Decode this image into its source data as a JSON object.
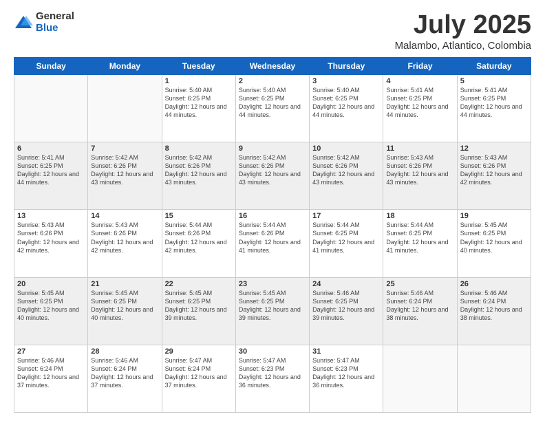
{
  "header": {
    "logo_general": "General",
    "logo_blue": "Blue",
    "title": "July 2025",
    "location": "Malambo, Atlantico, Colombia"
  },
  "days_of_week": [
    "Sunday",
    "Monday",
    "Tuesday",
    "Wednesday",
    "Thursday",
    "Friday",
    "Saturday"
  ],
  "weeks": [
    [
      {
        "day": "",
        "info": ""
      },
      {
        "day": "",
        "info": ""
      },
      {
        "day": "1",
        "info": "Sunrise: 5:40 AM\nSunset: 6:25 PM\nDaylight: 12 hours and 44 minutes."
      },
      {
        "day": "2",
        "info": "Sunrise: 5:40 AM\nSunset: 6:25 PM\nDaylight: 12 hours and 44 minutes."
      },
      {
        "day": "3",
        "info": "Sunrise: 5:40 AM\nSunset: 6:25 PM\nDaylight: 12 hours and 44 minutes."
      },
      {
        "day": "4",
        "info": "Sunrise: 5:41 AM\nSunset: 6:25 PM\nDaylight: 12 hours and 44 minutes."
      },
      {
        "day": "5",
        "info": "Sunrise: 5:41 AM\nSunset: 6:25 PM\nDaylight: 12 hours and 44 minutes."
      }
    ],
    [
      {
        "day": "6",
        "info": "Sunrise: 5:41 AM\nSunset: 6:25 PM\nDaylight: 12 hours and 44 minutes."
      },
      {
        "day": "7",
        "info": "Sunrise: 5:42 AM\nSunset: 6:26 PM\nDaylight: 12 hours and 43 minutes."
      },
      {
        "day": "8",
        "info": "Sunrise: 5:42 AM\nSunset: 6:26 PM\nDaylight: 12 hours and 43 minutes."
      },
      {
        "day": "9",
        "info": "Sunrise: 5:42 AM\nSunset: 6:26 PM\nDaylight: 12 hours and 43 minutes."
      },
      {
        "day": "10",
        "info": "Sunrise: 5:42 AM\nSunset: 6:26 PM\nDaylight: 12 hours and 43 minutes."
      },
      {
        "day": "11",
        "info": "Sunrise: 5:43 AM\nSunset: 6:26 PM\nDaylight: 12 hours and 43 minutes."
      },
      {
        "day": "12",
        "info": "Sunrise: 5:43 AM\nSunset: 6:26 PM\nDaylight: 12 hours and 42 minutes."
      }
    ],
    [
      {
        "day": "13",
        "info": "Sunrise: 5:43 AM\nSunset: 6:26 PM\nDaylight: 12 hours and 42 minutes."
      },
      {
        "day": "14",
        "info": "Sunrise: 5:43 AM\nSunset: 6:26 PM\nDaylight: 12 hours and 42 minutes."
      },
      {
        "day": "15",
        "info": "Sunrise: 5:44 AM\nSunset: 6:26 PM\nDaylight: 12 hours and 42 minutes."
      },
      {
        "day": "16",
        "info": "Sunrise: 5:44 AM\nSunset: 6:26 PM\nDaylight: 12 hours and 41 minutes."
      },
      {
        "day": "17",
        "info": "Sunrise: 5:44 AM\nSunset: 6:25 PM\nDaylight: 12 hours and 41 minutes."
      },
      {
        "day": "18",
        "info": "Sunrise: 5:44 AM\nSunset: 6:25 PM\nDaylight: 12 hours and 41 minutes."
      },
      {
        "day": "19",
        "info": "Sunrise: 5:45 AM\nSunset: 6:25 PM\nDaylight: 12 hours and 40 minutes."
      }
    ],
    [
      {
        "day": "20",
        "info": "Sunrise: 5:45 AM\nSunset: 6:25 PM\nDaylight: 12 hours and 40 minutes."
      },
      {
        "day": "21",
        "info": "Sunrise: 5:45 AM\nSunset: 6:25 PM\nDaylight: 12 hours and 40 minutes."
      },
      {
        "day": "22",
        "info": "Sunrise: 5:45 AM\nSunset: 6:25 PM\nDaylight: 12 hours and 39 minutes."
      },
      {
        "day": "23",
        "info": "Sunrise: 5:45 AM\nSunset: 6:25 PM\nDaylight: 12 hours and 39 minutes."
      },
      {
        "day": "24",
        "info": "Sunrise: 5:46 AM\nSunset: 6:25 PM\nDaylight: 12 hours and 39 minutes."
      },
      {
        "day": "25",
        "info": "Sunrise: 5:46 AM\nSunset: 6:24 PM\nDaylight: 12 hours and 38 minutes."
      },
      {
        "day": "26",
        "info": "Sunrise: 5:46 AM\nSunset: 6:24 PM\nDaylight: 12 hours and 38 minutes."
      }
    ],
    [
      {
        "day": "27",
        "info": "Sunrise: 5:46 AM\nSunset: 6:24 PM\nDaylight: 12 hours and 37 minutes."
      },
      {
        "day": "28",
        "info": "Sunrise: 5:46 AM\nSunset: 6:24 PM\nDaylight: 12 hours and 37 minutes."
      },
      {
        "day": "29",
        "info": "Sunrise: 5:47 AM\nSunset: 6:24 PM\nDaylight: 12 hours and 37 minutes."
      },
      {
        "day": "30",
        "info": "Sunrise: 5:47 AM\nSunset: 6:23 PM\nDaylight: 12 hours and 36 minutes."
      },
      {
        "day": "31",
        "info": "Sunrise: 5:47 AM\nSunset: 6:23 PM\nDaylight: 12 hours and 36 minutes."
      },
      {
        "day": "",
        "info": ""
      },
      {
        "day": "",
        "info": ""
      }
    ]
  ]
}
